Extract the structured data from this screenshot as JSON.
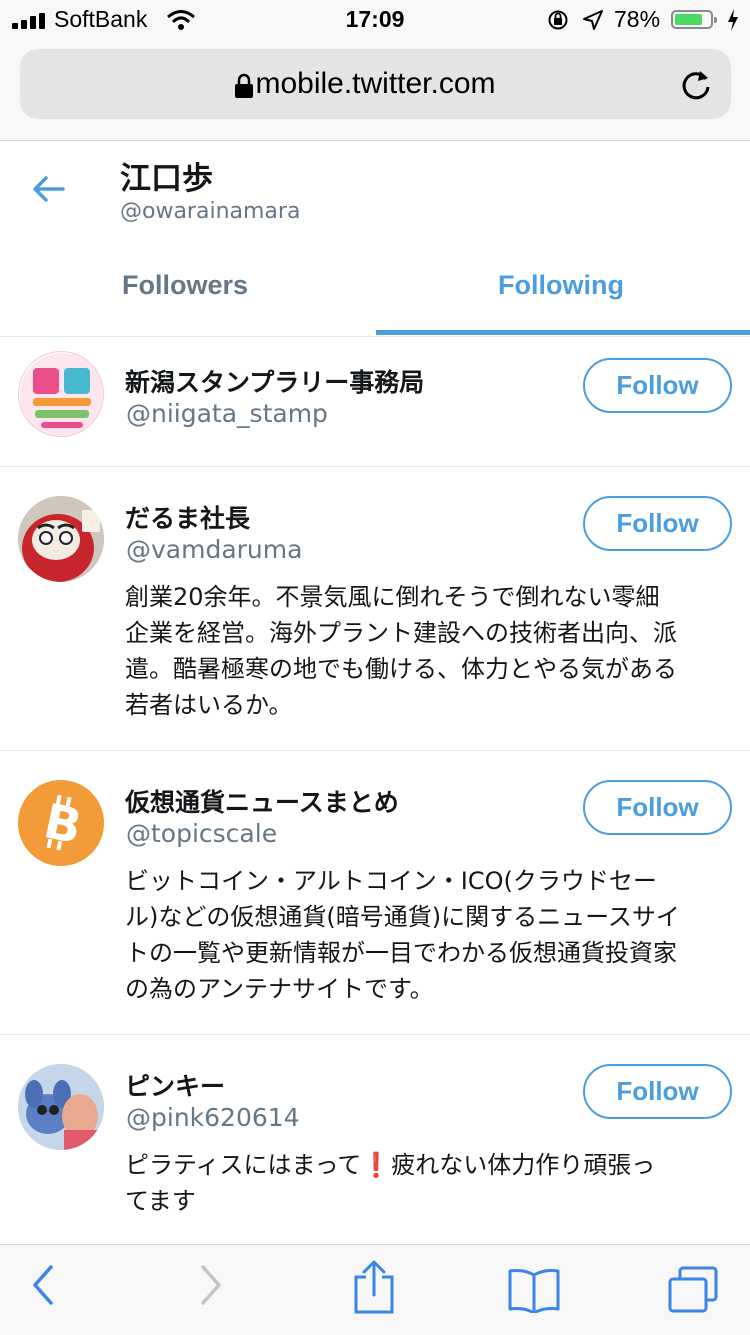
{
  "status_bar": {
    "carrier": "SoftBank",
    "time": "17:09",
    "battery_percent": "78%",
    "battery_level": 0.78
  },
  "browser": {
    "url": "mobile.twitter.com"
  },
  "profile": {
    "name": "江口歩",
    "handle": "@owarainamara"
  },
  "tabs": [
    {
      "label": "Followers",
      "active": false
    },
    {
      "label": "Following",
      "active": true
    }
  ],
  "accounts": [
    {
      "name": "新潟スタンプラリー事務局",
      "handle": "@niigata_stamp",
      "bio": [],
      "follow_label": "Follow",
      "avatar": "niigata-stamp-logo"
    },
    {
      "name": "だるま社長",
      "handle": "@vamdaruma",
      "bio": [
        "創業20余年。不景気風に倒れそうで倒れない零細",
        "企業を経営。海外プラント建設への技術者出向、派",
        "遣。酷暑極寒の地でも働ける、体力とやる気がある",
        "若者はいるか。"
      ],
      "follow_label": "Follow",
      "avatar": "daruma-photo"
    },
    {
      "name": "仮想通貨ニュースまとめ",
      "handle": "@topicscale",
      "bio": [
        "ビットコイン・アルトコイン・ICO(クラウドセー",
        "ル)などの仮想通貨(暗号通貨)に関するニュースサイ",
        "トの一覧や更新情報が一目でわかる仮想通貨投資家",
        "の為のアンテナサイトです。"
      ],
      "follow_label": "Follow",
      "avatar": "bitcoin-logo"
    },
    {
      "name": "ピンキー",
      "handle": "@pink620614",
      "bio": [
        "ピラティスにはまって❗疲れない体力作り頑張っ",
        "てます"
      ],
      "follow_label": "Follow",
      "avatar": "character-photo"
    }
  ],
  "icons": {
    "back": "arrow-left-icon",
    "lock": "lock-icon",
    "reload": "reload-icon",
    "toolbar": [
      "back-chevron-icon",
      "forward-chevron-icon",
      "share-icon",
      "bookmarks-icon",
      "tabs-icon"
    ]
  },
  "colors": {
    "accent": "#4a9ee0",
    "secondary_text": "#657786",
    "divider": "#e1e8ed",
    "battery": "#4cd964"
  }
}
